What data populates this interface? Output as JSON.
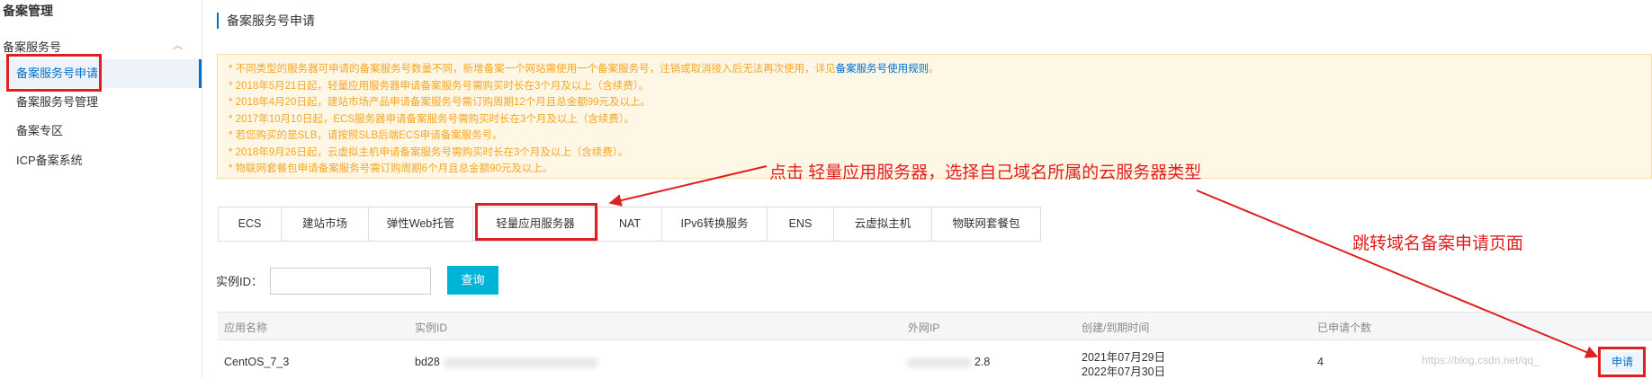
{
  "sidebar": {
    "title": "备案管理",
    "group": "备案服务号",
    "items": [
      {
        "label": "备案服务号申请"
      },
      {
        "label": "备案服务号管理"
      },
      {
        "label": "备案专区"
      },
      {
        "label": "ICP备案系统"
      }
    ]
  },
  "page_title": "备案服务号申请",
  "notice": {
    "line1_pre": "* 不同类型的服务器可申请的备案服务号数量不同，新增备案一个网站需使用一个备案服务号，注销或取消接入后无法再次使用，详见",
    "line1_link": "备案服务号使用规则",
    "line1_post": "。",
    "lines": [
      "* 2018年5月21日起，轻量应用服务器申请备案服务号需购买时长在3个月及以上（含续费）。",
      "* 2018年4月20日起，建站市场产品申请备案服务号需订购周期12个月且总金额99元及以上。",
      "* 2017年10月10日起，ECS服务器申请备案服务号需购买时长在3个月及以上（含续费）。",
      "* 若您购买的是SLB，请按照SLB后端ECS申请备案服务号。",
      "* 2018年9月26日起，云虚拟主机申请备案服务号需购买时长在3个月及以上（含续费）。",
      "* 物联网套餐包申请备案服务号需订购周期6个月且总金额90元及以上。"
    ]
  },
  "annotations": {
    "tab_hint": "点击 轻量应用服务器，选择自己域名所属的云服务器类型",
    "redirect_hint": "跳转域名备案申请页面"
  },
  "tabs": [
    "ECS",
    "建站市场",
    "弹性Web托管",
    "轻量应用服务器",
    "NAT",
    "IPv6转换服务",
    "ENS",
    "云虚拟主机",
    "物联网套餐包"
  ],
  "filter": {
    "label": "实例ID：",
    "input_value": "",
    "button": "查询"
  },
  "table": {
    "headers": [
      "应用名称",
      "实例ID",
      "外网IP",
      "创建/到期时间",
      "已申请个数"
    ],
    "rows": [
      {
        "app_name": "CentOS_7_3",
        "instance_id": "bd28",
        "ip": "2.8",
        "created": "2021年07月29日",
        "expires": "2022年07月30日",
        "count": "4",
        "action": "申请"
      }
    ]
  },
  "watermark": "https://blog.csdn.net/qq_",
  "colors": {
    "accent": "#0070cc",
    "annotation": "#e02020",
    "notice_text": "#f5a623",
    "query_button": "#00b4d8"
  }
}
